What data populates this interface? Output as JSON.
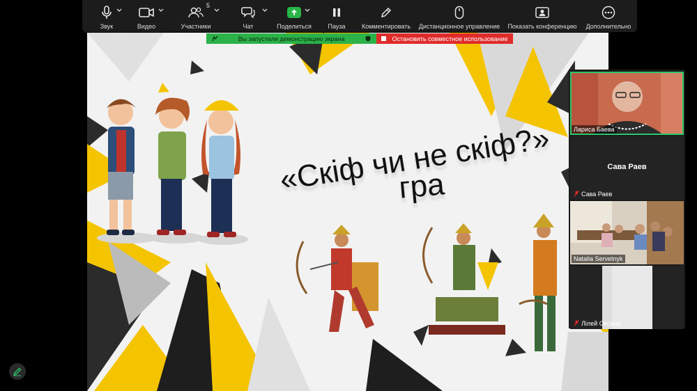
{
  "toolbar": {
    "items": [
      {
        "label": "Звук",
        "icon": "microphone-icon"
      },
      {
        "label": "Видео",
        "icon": "video-camera-icon"
      },
      {
        "label": "Участники",
        "icon": "participants-icon",
        "count": "5"
      },
      {
        "label": "Чат",
        "icon": "chat-icon"
      },
      {
        "label": "Поделиться",
        "icon": "share-screen-icon"
      },
      {
        "label": "Пауза",
        "icon": "pause-icon"
      },
      {
        "label": "Комментировать",
        "icon": "pen-icon"
      },
      {
        "label": "Дистанционное управление",
        "icon": "mouse-icon"
      },
      {
        "label": "Показать конференцию",
        "icon": "meeting-view-icon"
      },
      {
        "label": "Дополнительно",
        "icon": "more-icon"
      }
    ]
  },
  "share_banner": {
    "status": "Вы запустили демонстрацию экрана",
    "stop_label": "Остановить совместное использование",
    "status_color": "#2bb34a",
    "stop_color": "#e02b2b"
  },
  "slide": {
    "title": "«Скіф чи не скіф?»",
    "subtitle": "гра",
    "accent_color": "#f5c400"
  },
  "participants": [
    {
      "name": "Лариса Баева",
      "video": true,
      "active": true
    },
    {
      "name": "Сава Раев",
      "display_name": "Сава Раев",
      "video": false,
      "muted": true
    },
    {
      "name": "Natalia Servetnyk",
      "video": true
    },
    {
      "name": "Лілей Оксана",
      "video": true,
      "muted": true
    }
  ]
}
